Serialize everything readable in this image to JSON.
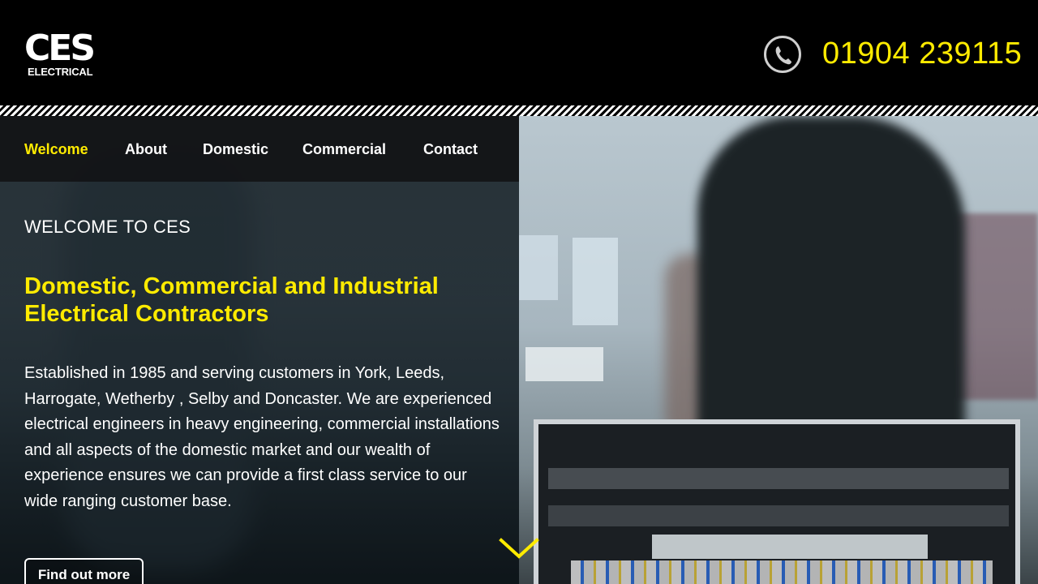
{
  "header": {
    "logo": {
      "main": "CES",
      "sub": "ELECTRICAL"
    },
    "phone_icon": "phone-icon",
    "phone_number": "01904 239115"
  },
  "nav": {
    "items": [
      {
        "label": "Welcome",
        "active": true
      },
      {
        "label": "About",
        "active": false
      },
      {
        "label": "Domestic",
        "active": false
      },
      {
        "label": "Commercial",
        "active": false
      },
      {
        "label": "Contact",
        "active": false
      }
    ]
  },
  "hero": {
    "eyebrow": "WELCOME TO CES",
    "headline": "Domestic, Commercial and Industrial Electrical Contractors",
    "intro": "Established in 1985 and serving customers in York, Leeds, Harrogate, Wetherby , Selby and Doncaster. We are experienced electrical engineers in heavy engineering, commercial installations and all aspects of the domestic market and our wealth of experience ensures we can provide a first class service to our wide ranging customer base.",
    "cta_label": "Find out more",
    "scroll_icon": "chevron-down-icon"
  },
  "colors": {
    "accent": "#ffeb00",
    "background": "#000000",
    "text": "#ffffff"
  }
}
